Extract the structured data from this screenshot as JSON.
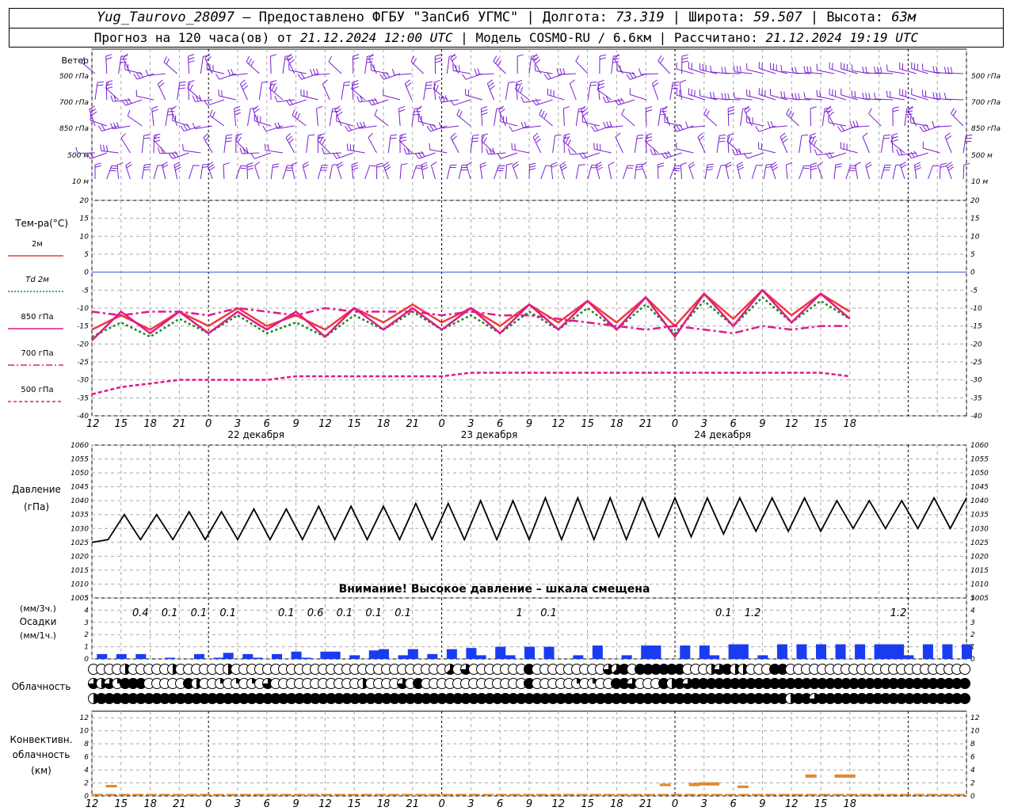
{
  "header": {
    "station": "Yug_Taurovo_28097",
    "provider": "– Предоставлено ФГБУ \"ЗапСиб УГМС\"",
    "lon_label": "Долгота:",
    "lon": "73.319",
    "lat_label": "Широта:",
    "lat": "59.507",
    "alt_label": "Высота:",
    "alt": "63м",
    "forecast_prefix": "Прогноз на 120 часа(ов) от",
    "forecast_time": "21.12.2024 12:00 UTC",
    "model_label": "Модель",
    "model": "COSMO-RU / 6.6км",
    "calc_label": "Рассчитано:",
    "calc_time": "21.12.2024 19:19 UTC"
  },
  "chart_data": [
    {
      "type": "wind-barbs",
      "row_title": "Ветер",
      "levels": [
        "500 гПа",
        "700 гПа",
        "850 гПа",
        "500 м",
        "10 м"
      ],
      "barb_color": "#7a1fd0",
      "time_steps": 75
    },
    {
      "type": "line",
      "title": "Тем-ра(°C)",
      "ylim": [
        -40,
        20
      ],
      "yticks": [
        20,
        15,
        10,
        5,
        0,
        -5,
        -10,
        -15,
        -20,
        -25,
        -30,
        -35,
        -40
      ],
      "zero_line_color": "#3050e0",
      "legend": [
        {
          "label": "2м",
          "color": "#f03a3a",
          "style": "solid"
        },
        {
          "label": "Td  2м",
          "color": "#1a8a1a",
          "style": "dotted"
        },
        {
          "label": "850 гПа",
          "color": "#e01a8a",
          "style": "solid"
        },
        {
          "label": "700 гПа",
          "color": "#e01a8a",
          "style": "dashdot"
        },
        {
          "label": "500 гПа",
          "color": "#e01a8a",
          "style": "dashed"
        }
      ],
      "x_hours": [
        0,
        3,
        6,
        9,
        12,
        15,
        18,
        21,
        24,
        27,
        30,
        33,
        36,
        39,
        42,
        45,
        48,
        51,
        54,
        57,
        60,
        63,
        66,
        69,
        72,
        75,
        78
      ],
      "series": [
        {
          "name": "2м",
          "values": [
            -16,
            -12,
            -16,
            -11,
            -15,
            -10,
            -15,
            -12,
            -16,
            -10,
            -14,
            -9,
            -14,
            -10,
            -15,
            -9,
            -14,
            -8,
            -14,
            -7,
            -15,
            -6,
            -13,
            -5,
            -12,
            -6,
            -11
          ]
        },
        {
          "name": "Td  2м",
          "values": [
            -18,
            -14,
            -18,
            -13,
            -17,
            -12,
            -17,
            -14,
            -18,
            -12,
            -16,
            -11,
            -16,
            -12,
            -17,
            -11,
            -16,
            -10,
            -16,
            -9,
            -17,
            -8,
            -15,
            -7,
            -14,
            -8,
            -13
          ]
        },
        {
          "name": "850 гПа",
          "values": [
            -19,
            -11,
            -17,
            -11,
            -17,
            -11,
            -16,
            -11,
            -18,
            -10,
            -16,
            -10,
            -16,
            -10,
            -17,
            -9,
            -16,
            -8,
            -16,
            -7,
            -18,
            -6,
            -15,
            -5,
            -14,
            -6,
            -13
          ]
        },
        {
          "name": "700 гПа",
          "values": [
            -11,
            -12,
            -11,
            -11,
            -12,
            -10,
            -11,
            -12,
            -10,
            -11,
            -11,
            -11,
            -12,
            -11,
            -12,
            -12,
            -13,
            -14,
            -15,
            -16,
            -15,
            -16,
            -17,
            -15,
            -16,
            -15,
            -15
          ]
        },
        {
          "name": "500 гПа",
          "values": [
            -34,
            -32,
            -31,
            -30,
            -30,
            -30,
            -30,
            -29,
            -29,
            -29,
            -29,
            -29,
            -29,
            -28,
            -28,
            -28,
            -28,
            -28,
            -28,
            -28,
            -28,
            -28,
            -28,
            -28,
            -28,
            -28,
            -29
          ]
        }
      ]
    },
    {
      "type": "line",
      "title": "Давление",
      "unit": "(гПа)",
      "ylim": [
        1005,
        1060
      ],
      "yticks": [
        1060,
        1055,
        1050,
        1045,
        1040,
        1035,
        1030,
        1025,
        1020,
        1015,
        1010,
        1005
      ],
      "warning": "Внимание! Высокое давление – шкала смещена",
      "series": [
        {
          "name": "Давление",
          "color": "#000000",
          "values": [
            1025,
            1026,
            1035,
            1026,
            1035,
            1026,
            1036,
            1026,
            1036,
            1026,
            1037,
            1026,
            1037,
            1026,
            1038,
            1026,
            1038,
            1026,
            1038,
            1026,
            1039,
            1026,
            1039,
            1026,
            1040,
            1026,
            1040,
            1026,
            1041,
            1026,
            1041,
            1026,
            1041,
            1026,
            1041,
            1027,
            1041,
            1027,
            1041,
            1028,
            1041,
            1029,
            1041,
            1029,
            1041,
            1029,
            1040,
            1030,
            1040,
            1030,
            1040,
            1030,
            1041,
            1030,
            1041
          ]
        }
      ]
    },
    {
      "type": "bar",
      "title_3h": "(мм/3ч.)",
      "title": "Осадки",
      "title_1h": "(мм/1ч.)",
      "ylim": [
        0,
        5
      ],
      "yticks": [
        5,
        4,
        3,
        2,
        1,
        0
      ],
      "bar_color": "#1a3cf0",
      "labels_3h": [
        {
          "hour": 5,
          "text": "0.4"
        },
        {
          "hour": 8,
          "text": "0.1"
        },
        {
          "hour": 11,
          "text": "0.1"
        },
        {
          "hour": 14,
          "text": "0.1"
        },
        {
          "hour": 20,
          "text": "0.1"
        },
        {
          "hour": 23,
          "text": "0.6"
        },
        {
          "hour": 26,
          "text": "0.1"
        },
        {
          "hour": 29,
          "text": "0.1"
        },
        {
          "hour": 32,
          "text": "0.1"
        },
        {
          "hour": 44,
          "text": "1"
        },
        {
          "hour": 47,
          "text": "0.1"
        },
        {
          "hour": 65,
          "text": "0.1"
        },
        {
          "hour": 68,
          "text": "1.2"
        },
        {
          "hour": 83,
          "text": "1.2"
        }
      ],
      "hours": [
        1,
        3,
        5,
        8,
        11,
        13,
        14,
        16,
        17,
        19,
        21,
        22,
        24,
        25,
        27,
        29,
        30,
        32,
        33,
        35,
        37,
        39,
        40,
        42,
        43,
        45,
        47,
        50,
        52,
        55,
        57,
        58,
        61,
        63,
        64,
        66,
        67,
        69,
        71,
        73,
        75,
        77,
        79,
        81,
        82,
        83,
        84,
        86,
        88,
        90
      ],
      "values": [
        0.4,
        0.4,
        0.4,
        0.1,
        0.4,
        0.1,
        0.5,
        0.4,
        0.1,
        0.4,
        0.6,
        0.1,
        0.6,
        0.6,
        0.3,
        0.7,
        0.8,
        0.3,
        0.8,
        0.4,
        0.8,
        0.9,
        0.3,
        1.0,
        0.3,
        1.0,
        1.0,
        0.3,
        1.1,
        0.3,
        1.1,
        1.1,
        1.1,
        1.1,
        0.3,
        1.2,
        1.2,
        0.3,
        1.2,
        1.2,
        1.2,
        1.2,
        1.2,
        1.2,
        1.2,
        1.2,
        0.3,
        1.2,
        1.2,
        1.2
      ]
    },
    {
      "type": "heatmap",
      "title": "Облачность",
      "note": "rows of cloud-cover circles (0–8 octas)",
      "rows": [
        [
          0,
          0,
          0,
          0,
          4,
          0,
          0,
          0,
          0,
          0,
          4,
          0,
          0,
          0,
          0,
          0,
          0,
          4,
          0,
          0,
          0,
          0,
          0,
          0,
          0,
          0,
          0,
          0,
          0,
          0,
          0,
          0,
          0,
          0,
          0,
          0,
          0,
          0,
          0,
          0,
          0,
          0,
          0,
          0,
          0,
          5,
          0,
          6,
          0,
          0,
          0,
          0,
          0,
          0,
          0,
          8,
          0,
          0,
          0,
          0,
          0,
          0,
          0,
          0,
          0,
          6,
          5,
          8,
          0,
          8,
          8,
          8,
          8,
          8,
          8,
          0,
          0,
          0,
          4,
          6,
          8,
          4,
          4,
          0,
          0,
          0,
          8,
          8,
          0,
          0,
          0,
          0,
          0,
          0,
          0,
          0,
          0,
          0,
          0,
          0,
          0,
          0,
          0,
          0,
          0,
          0,
          0,
          0,
          0,
          0,
          0
        ],
        [
          6,
          4,
          6,
          2,
          8,
          8,
          8,
          0,
          0,
          0,
          0,
          0,
          8,
          4,
          0,
          0,
          2,
          0,
          2,
          0,
          2,
          0,
          6,
          0,
          0,
          0,
          0,
          0,
          0,
          0,
          0,
          0,
          0,
          0,
          4,
          0,
          0,
          0,
          0,
          6,
          0,
          8,
          0,
          0,
          0,
          0,
          0,
          0,
          0,
          0,
          0,
          0,
          0,
          0,
          0,
          8,
          0,
          0,
          0,
          0,
          0,
          2,
          0,
          2,
          0,
          0,
          8,
          8,
          6,
          0,
          0,
          0,
          8,
          4,
          8,
          6,
          8,
          8,
          8,
          8,
          8,
          8,
          8,
          8,
          8,
          8,
          8,
          8,
          8,
          8,
          8,
          8,
          8,
          8,
          8,
          8,
          8,
          8,
          8,
          8,
          8,
          8,
          8,
          8,
          8,
          8,
          8,
          8,
          8,
          8,
          8
        ],
        [
          4,
          8,
          8,
          8,
          8,
          8,
          8,
          8,
          8,
          8,
          8,
          8,
          8,
          8,
          8,
          8,
          8,
          8,
          8,
          8,
          8,
          8,
          8,
          8,
          8,
          8,
          8,
          8,
          8,
          8,
          8,
          8,
          8,
          8,
          8,
          8,
          8,
          8,
          8,
          8,
          8,
          8,
          8,
          8,
          8,
          8,
          8,
          8,
          8,
          8,
          8,
          8,
          8,
          8,
          8,
          8,
          8,
          8,
          8,
          8,
          8,
          8,
          8,
          8,
          8,
          8,
          8,
          8,
          8,
          8,
          8,
          8,
          8,
          8,
          8,
          8,
          8,
          8,
          8,
          8,
          8,
          8,
          8,
          8,
          8,
          8,
          8,
          8,
          4,
          8,
          8,
          6,
          8,
          8,
          8,
          8,
          8,
          8,
          8,
          8,
          8,
          8,
          8,
          8,
          8,
          8,
          8,
          8,
          8,
          8,
          8
        ]
      ]
    },
    {
      "type": "bar",
      "title": "Конвективн.",
      "title2": "облачность",
      "unit": "(км)",
      "ylim": [
        0,
        13
      ],
      "yticks": [
        12,
        10,
        8,
        6,
        4,
        2,
        0
      ],
      "bar_color": "#e08a30",
      "segments": [
        {
          "hour": 2,
          "low": 1.3,
          "high": 1.7
        },
        {
          "hour": 59,
          "low": 1.5,
          "high": 1.9
        },
        {
          "hour": 62,
          "low": 1.5,
          "high": 2.0
        },
        {
          "hour": 63,
          "low": 1.6,
          "high": 2.1
        },
        {
          "hour": 64,
          "low": 1.6,
          "high": 2.1
        },
        {
          "hour": 67,
          "low": 1.2,
          "high": 1.6
        },
        {
          "hour": 74,
          "low": 2.8,
          "high": 3.3
        },
        {
          "hour": 77,
          "low": 2.8,
          "high": 3.3
        },
        {
          "hour": 78,
          "low": 2.8,
          "high": 3.3
        }
      ]
    }
  ],
  "x_axis": {
    "hour_labels": [
      "12",
      "15",
      "18",
      "21",
      "0",
      "3",
      "6",
      "9",
      "12",
      "15",
      "18",
      "21",
      "0",
      "3",
      "6",
      "9",
      "12",
      "15",
      "18",
      "21",
      "0",
      "3",
      "6",
      "9",
      "12",
      "15",
      "18"
    ],
    "day_labels": [
      {
        "text": "22 декабря",
        "at": 12
      },
      {
        "text": "23 декабря",
        "at": 36
      },
      {
        "text": "24 декабря",
        "at": 60
      }
    ]
  }
}
